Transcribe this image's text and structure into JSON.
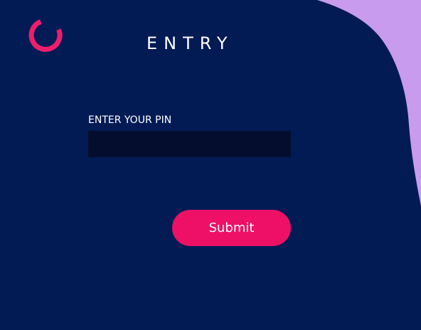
{
  "header": {
    "title": "ENTRY",
    "logo_icon": "ring-loader-icon"
  },
  "form": {
    "pin_label": "ENTER YOUR PIN",
    "pin_value": "",
    "submit_label": "Submit"
  },
  "colors": {
    "background": "#021b55",
    "accent_blob": "#c89bef",
    "logo": "#ef1e6c",
    "input_background": "#040d2d",
    "submit_button": "#ee1067",
    "text": "#ffffff"
  }
}
